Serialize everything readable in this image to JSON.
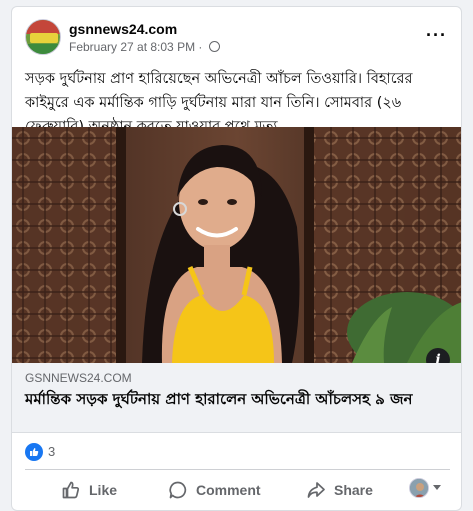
{
  "post": {
    "page_name": "gsnnews24.com",
    "timestamp": "February 27 at 8:03 PM",
    "separator": "·",
    "caption": "সড়ক দুর্ঘটনায় প্রাণ হারিয়েছেন অভিনেত্রী আঁচল তিওয়ারি। বিহারের কাইমুরে এক মর্মান্তিক গাড়ি দুর্ঘটনায় মারা যান তিনি। সোমবার (২৬ ফেব্রুয়ারি) অনুষ্ঠান করতে যাওয়ার পথে মৃত্যু"
  },
  "link_preview": {
    "domain": "GSNNEWS24.COM",
    "headline": "মর্মান্তিক সড়ক দুর্ঘটনায় প্রাণ হারালেন অভিনেত্রী আঁচলসহ ৯ জন"
  },
  "reactions": {
    "count": "3",
    "type_icon": "like-icon"
  },
  "actions": {
    "like_label": "Like",
    "comment_label": "Comment",
    "share_label": "Share"
  },
  "colors": {
    "accent": "#1877f2",
    "secondary_text": "#65676b",
    "dress": "#f5c518"
  }
}
